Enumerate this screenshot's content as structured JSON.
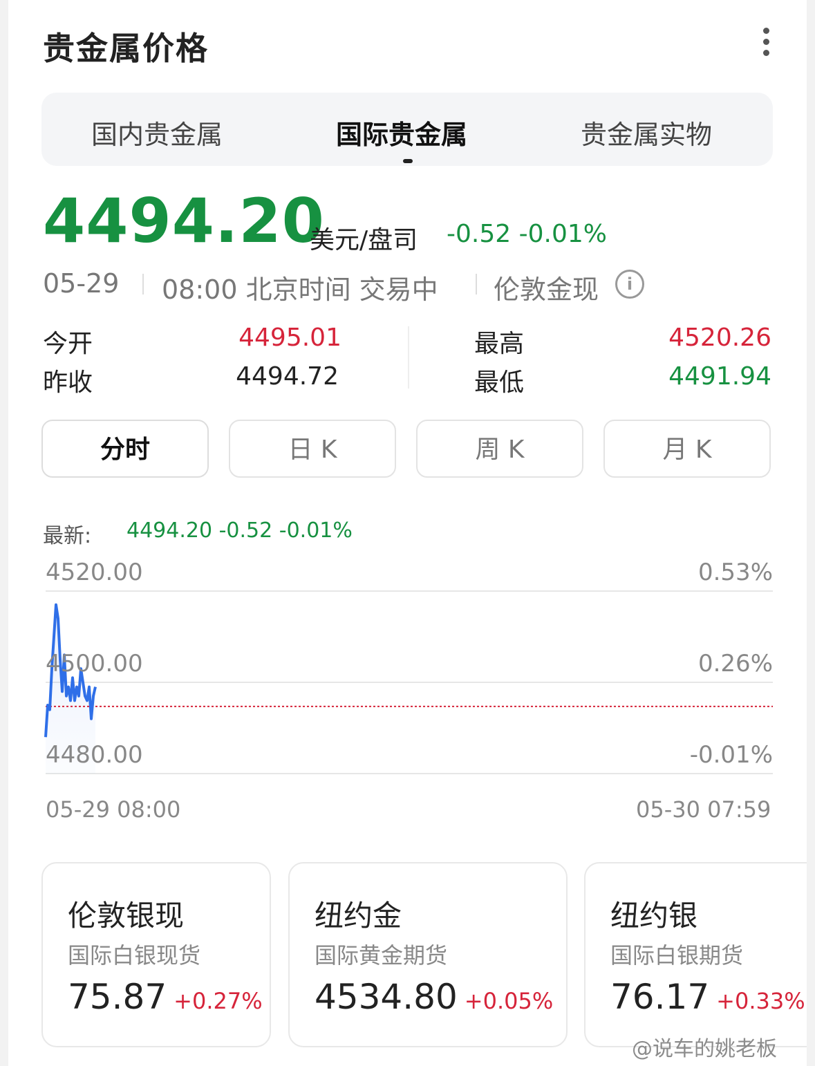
{
  "header": {
    "title": "贵金属价格"
  },
  "tabs": [
    {
      "label": "国内贵金属",
      "active": false
    },
    {
      "label": "国际贵金属",
      "active": true
    },
    {
      "label": "贵金属实物",
      "active": false
    }
  ],
  "quote": {
    "price": "4494.20",
    "unit": "美元/盘司",
    "change": "-0.52",
    "change_pct": "-0.01%",
    "date": "05-29",
    "time": "08:00 北京时间 交易中",
    "market": "伦敦金现"
  },
  "stats": {
    "open_label": "今开",
    "open_value": "4495.01",
    "prev_close_label": "昨收",
    "prev_close_value": "4494.72",
    "high_label": "最高",
    "high_value": "4520.26",
    "low_label": "最低",
    "low_value": "4491.94"
  },
  "period_buttons": [
    {
      "label": "分时",
      "active": true
    },
    {
      "label": "日 K",
      "active": false
    },
    {
      "label": "周 K",
      "active": false
    },
    {
      "label": "月 K",
      "active": false
    }
  ],
  "chart_data": {
    "type": "line",
    "latest_label": "最新:",
    "latest_value": "4494.20 -0.52 -0.01%",
    "y_ticks_left": [
      "4520.00",
      "4500.00",
      "4480.00"
    ],
    "y_ticks_right": [
      "0.53%",
      "0.26%",
      "-0.01%"
    ],
    "x_labels": [
      "05-29 08:00",
      "05-30 07:59"
    ],
    "ylim": [
      4480,
      4520
    ],
    "reference_line": 4494.72,
    "grid": true,
    "series": [
      {
        "values": [
          4488,
          4495,
          4494,
          4503,
          4510,
          4517,
          4514,
          4505,
          4498,
          4506,
          4497,
          4499,
          4496,
          4501,
          4496,
          4499,
          4497,
          4503,
          4500,
          4497,
          4496,
          4499,
          4492,
          4497,
          4499
        ]
      }
    ]
  },
  "colors": {
    "up": "#d6243a",
    "down": "#179141",
    "line": "#2f6fe8",
    "ref_line": "#d6243a"
  },
  "mini_cards": [
    {
      "name": "伦敦银现",
      "sub": "国际白银现货",
      "price": "75.87",
      "pct": "+0.27%"
    },
    {
      "name": "纽约金",
      "sub": "国际黄金期货",
      "price": "4534.80",
      "pct": "+0.05%"
    },
    {
      "name": "纽约银",
      "sub": "国际白银期货",
      "price": "76.17",
      "pct": "+0.33%"
    }
  ],
  "watermark": "@说车的姚老板"
}
